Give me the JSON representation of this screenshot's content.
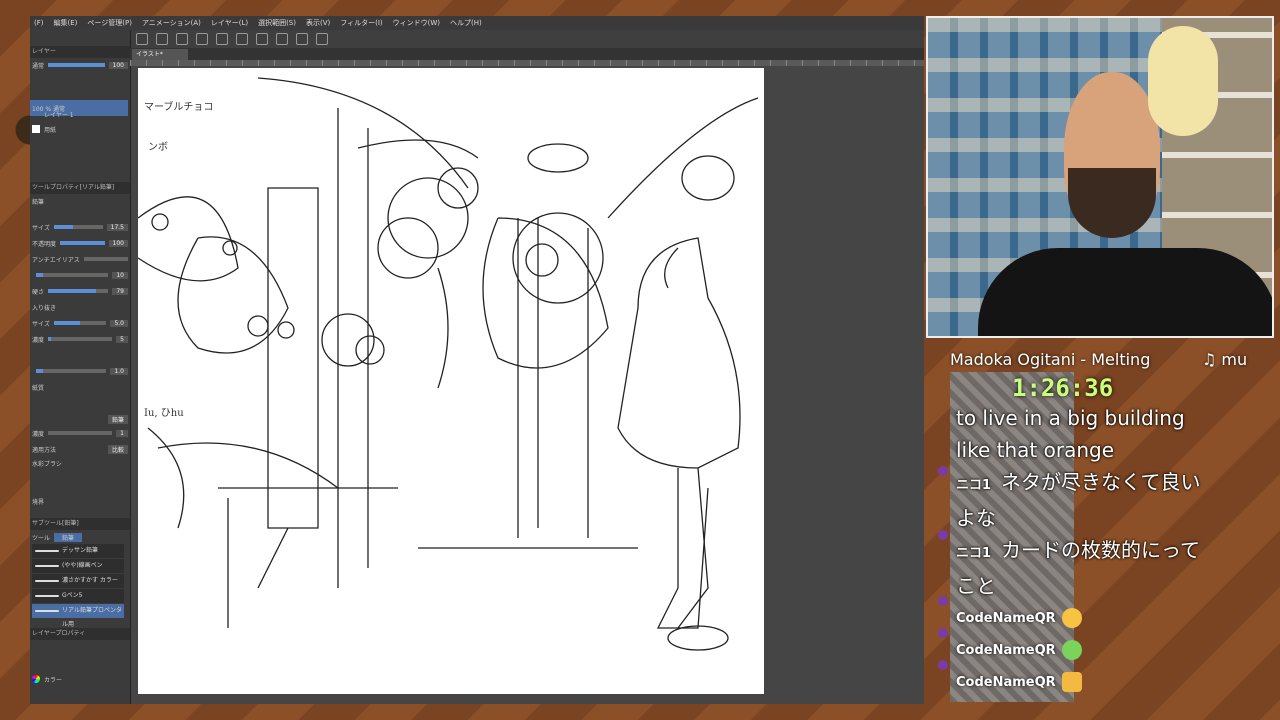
{
  "app": {
    "menus": [
      "(F)",
      "編集(E)",
      "ページ管理(P)",
      "アニメーション(A)",
      "レイヤー(L)",
      "選択範囲(S)",
      "表示(V)",
      "フィルター(I)",
      "ウィンドウ(W)",
      "ヘルプ(H)"
    ],
    "left_panel": {
      "layer_section": "レイヤー",
      "blend_mode": "通常",
      "opacity": "100",
      "layers": [
        {
          "name": "100 % 通常",
          "sub": "レイヤー 1"
        },
        {
          "name": "用紙"
        }
      ],
      "tool_property_section": "ツールプロパティ[リアル鉛筆]",
      "tool_sub": "鉛筆",
      "properties": [
        {
          "label": "サイズ",
          "value": "17.5"
        },
        {
          "label": "不透明度",
          "value": "100"
        },
        {
          "label": "アンチエイリアス",
          "value": ""
        },
        {
          "label": "",
          "value": "10"
        },
        {
          "label": "硬さ",
          "value": "79"
        },
        {
          "label": "入り抜き",
          "value": ""
        },
        {
          "label": "サイズ",
          "value": "5.0"
        },
        {
          "label": "濃度",
          "value": "5"
        },
        {
          "label": "",
          "value": "1.0"
        },
        {
          "label": "紙質",
          "value": ""
        },
        {
          "label": "",
          "value": "鉛筆"
        },
        {
          "label": "濃度",
          "value": "1"
        },
        {
          "label": "適用方法",
          "value": "比較"
        },
        {
          "label": "水彩ブラシ",
          "value": ""
        },
        {
          "label": "境界",
          "value": ""
        }
      ],
      "subtool_section": "サブツール[鉛筆]",
      "subtool_tabs": [
        "ツール",
        "鉛筆"
      ],
      "brushes": [
        {
          "name": "デッサン鉛筆"
        },
        {
          "name": "(やや)線画ペン"
        },
        {
          "name": "濃さかすかす カラー"
        },
        {
          "name": "Gペン5"
        },
        {
          "name": "リアル鉛筆プロペンタル用"
        }
      ],
      "layer_property_section": "レイヤープロパティ",
      "color_label": "カラー"
    },
    "document_tab": "イラスト*",
    "canvas_notes": [
      "マーブルチョコ",
      "ンボ",
      "Iu, ひhu"
    ]
  },
  "overlay": {
    "song": "Madoka Ogitani - Melting",
    "song_marquee": "♫ mu",
    "timer": "1:26:36",
    "chat": [
      {
        "type": "text",
        "text": "to live in a big building"
      },
      {
        "type": "text",
        "text": "like that orange"
      },
      {
        "type": "prefixed",
        "prefix": "ニコ1",
        "text": "ネタが尽きなくて良い"
      },
      {
        "type": "text",
        "text": "よな"
      },
      {
        "type": "prefixed",
        "prefix": "ニコ1",
        "text": "カードの枚数的にって"
      },
      {
        "type": "text",
        "text": "こと"
      },
      {
        "type": "user",
        "user": "CodeNameQR",
        "emote_color": "#f6c343"
      },
      {
        "type": "user",
        "user": "CodeNameQR",
        "emote_color": "#7ad35a"
      },
      {
        "type": "user",
        "user": "CodeNameQR",
        "emote_color": "#f3b940"
      }
    ]
  }
}
